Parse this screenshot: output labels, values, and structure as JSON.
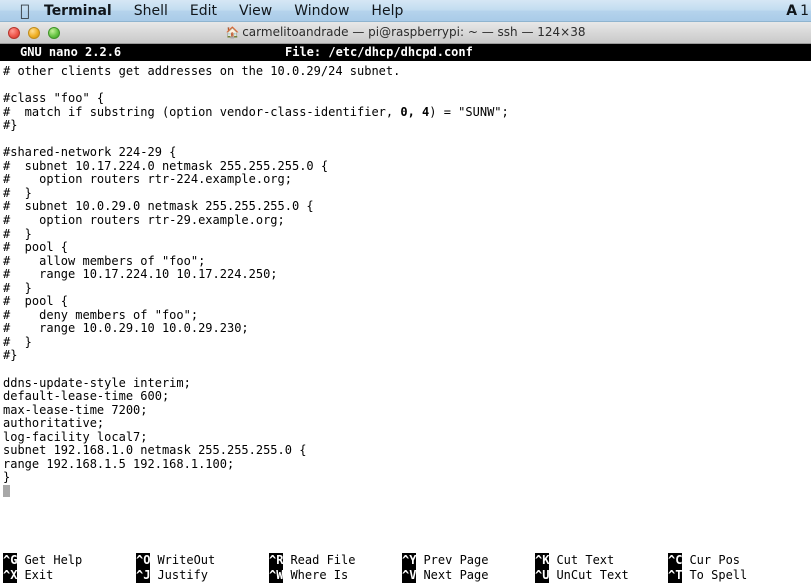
{
  "menubar": {
    "apple_icon": "apple-logo-icon",
    "items": [
      {
        "label": "Terminal",
        "bold": true
      },
      {
        "label": "Shell",
        "bold": false
      },
      {
        "label": "Edit",
        "bold": false
      },
      {
        "label": "View",
        "bold": false
      },
      {
        "label": "Window",
        "bold": false
      },
      {
        "label": "Help",
        "bold": false
      }
    ],
    "status_icon": "A",
    "clock": "1"
  },
  "window": {
    "home_icon": "home-icon",
    "title": "carmelitoandrade — pi@raspberrypi: ~ — ssh — 124×38",
    "controls": {
      "close": "close-button",
      "minimize": "minimize-button",
      "zoom": "zoom-button"
    }
  },
  "nano": {
    "header": {
      "version": "GNU nano 2.2.6",
      "file_label": "File: /etc/dhcp/dhcpd.conf"
    },
    "lines": [
      "# other clients get addresses on the 10.0.29/24 subnet.",
      "",
      "#class \"foo\" {",
      "#  match if substring (option vendor-class-identifier, 0, 4) = \"SUNW\";",
      "#}",
      "",
      "#shared-network 224-29 {",
      "#  subnet 10.17.224.0 netmask 255.255.255.0 {",
      "#    option routers rtr-224.example.org;",
      "#  }",
      "#  subnet 10.0.29.0 netmask 255.255.255.0 {",
      "#    option routers rtr-29.example.org;",
      "#  }",
      "#  pool {",
      "#    allow members of \"foo\";",
      "#    range 10.17.224.10 10.17.224.250;",
      "#  }",
      "#  pool {",
      "#    deny members of \"foo\";",
      "#    range 10.0.29.10 10.0.29.230;",
      "#  }",
      "#}",
      "",
      "ddns-update-style interim;",
      "default-lease-time 600;",
      "max-lease-time 7200;",
      "authoritative;",
      "log-facility local7;",
      "subnet 192.168.1.0 netmask 255.255.255.0 {",
      "range 192.168.1.5 192.168.1.100;",
      "}"
    ],
    "cursor": {
      "line_index": 31,
      "column": 0
    },
    "shortcuts_row1": [
      {
        "key": "^G",
        "label": "Get Help"
      },
      {
        "key": "^O",
        "label": "WriteOut"
      },
      {
        "key": "^R",
        "label": "Read File"
      },
      {
        "key": "^Y",
        "label": "Prev Page"
      },
      {
        "key": "^K",
        "label": "Cut Text"
      },
      {
        "key": "^C",
        "label": "Cur Pos"
      }
    ],
    "shortcuts_row2": [
      {
        "key": "^X",
        "label": "Exit"
      },
      {
        "key": "^J",
        "label": "Justify"
      },
      {
        "key": "^W",
        "label": "Where Is"
      },
      {
        "key": "^V",
        "label": "Next Page"
      },
      {
        "key": "^U",
        "label": "UnCut Text"
      },
      {
        "key": "^T",
        "label": "To Spell"
      }
    ]
  },
  "colors": {
    "terminal_bg": "#ffffff",
    "terminal_fg": "#000000",
    "inverse_bg": "#000000",
    "inverse_fg": "#ffffff",
    "cursor": "#a8a8a8",
    "menubar_top": "#d6e7f5",
    "menubar_bottom": "#a9cbe8"
  }
}
